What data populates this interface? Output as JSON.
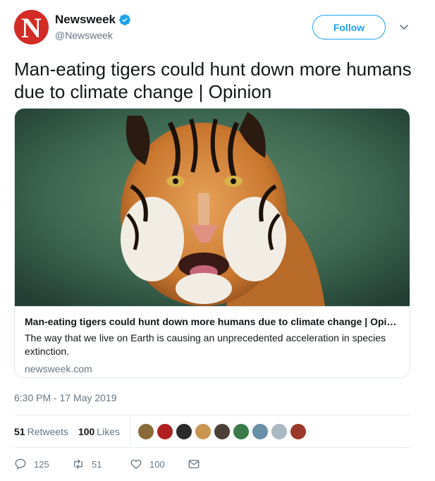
{
  "account": {
    "display_name": "Newsweek",
    "handle": "@Newsweek",
    "avatar_letter": "N",
    "verified": true,
    "follow_label": "Follow"
  },
  "tweet": {
    "text": "Man-eating tigers could hunt down more humans due to climate change | Opinion",
    "timestamp": "6:30 PM - 17 May 2019"
  },
  "card": {
    "image_subject": "tiger-photo",
    "title": "Man-eating tigers could hunt down more humans due to climate change | Opinion",
    "description": "The way that we live on Earth is causing an unprecedented acceleration in species extinction.",
    "domain": "newsweek.com"
  },
  "stats": {
    "retweets_count": "51",
    "retweets_label": "Retweets",
    "likes_count": "100",
    "likes_label": "Likes"
  },
  "actions": {
    "replies": "125",
    "retweets": "51",
    "likes": "100"
  },
  "colors": {
    "accent": "#1da1f2",
    "brand_red": "#d32b25",
    "muted_text": "#657786"
  }
}
